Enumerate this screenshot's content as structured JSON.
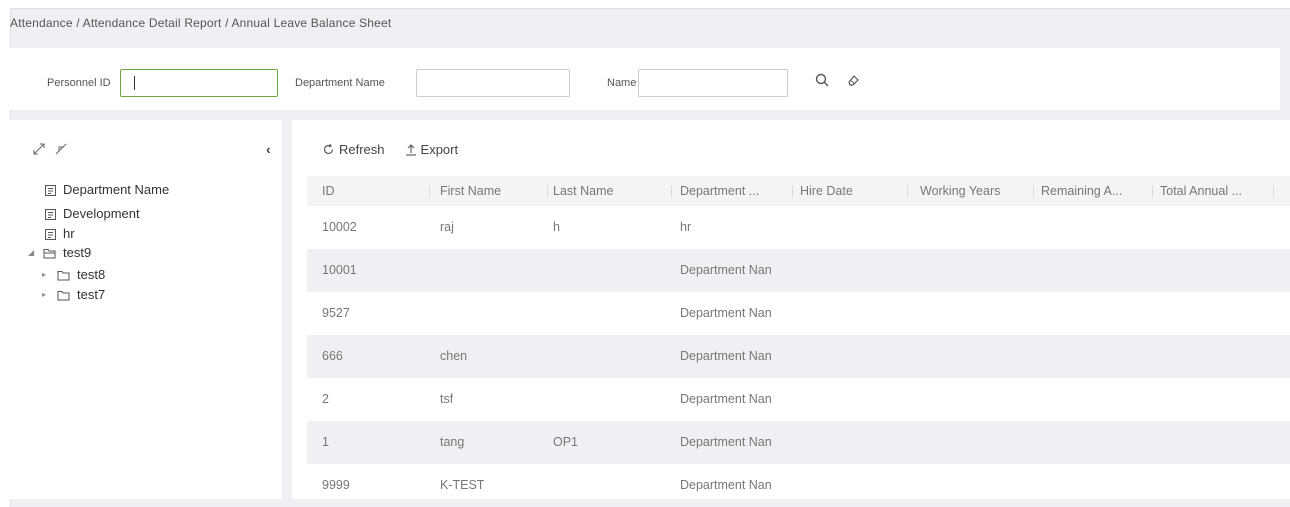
{
  "breadcrumb": "Attendance / Attendance Detail Report / Annual Leave Balance Sheet",
  "search": {
    "personnel_id_label": "Personnel ID",
    "personnel_id_value": "",
    "department_name_label": "Department Name",
    "department_name_value": "",
    "name_label": "Name",
    "name_value": ""
  },
  "tree": {
    "items": [
      {
        "label": "Department Name"
      },
      {
        "label": "Development"
      },
      {
        "label": "hr"
      },
      {
        "label": "test9"
      },
      {
        "label": "test8"
      },
      {
        "label": "test7"
      }
    ]
  },
  "toolbar": {
    "refresh_label": "Refresh",
    "export_label": "Export"
  },
  "grid": {
    "columns": [
      "ID",
      "First Name",
      "Last Name",
      "Department ...",
      "Hire Date",
      "Working Years",
      "Remaining A...",
      "Total Annual ..."
    ],
    "rows": [
      [
        "10002",
        "raj",
        "h",
        "hr"
      ],
      [
        "10001",
        "",
        "",
        "Department Nan"
      ],
      [
        "9527",
        "",
        "",
        "Department Nan"
      ],
      [
        "666",
        "chen",
        "",
        "Department Nan"
      ],
      [
        "2",
        "tsf",
        "",
        "Department Nan"
      ],
      [
        "1",
        "tang",
        "OP1",
        "Department Nan"
      ],
      [
        "9999",
        "K-TEST",
        "",
        "Department Nan"
      ]
    ]
  }
}
